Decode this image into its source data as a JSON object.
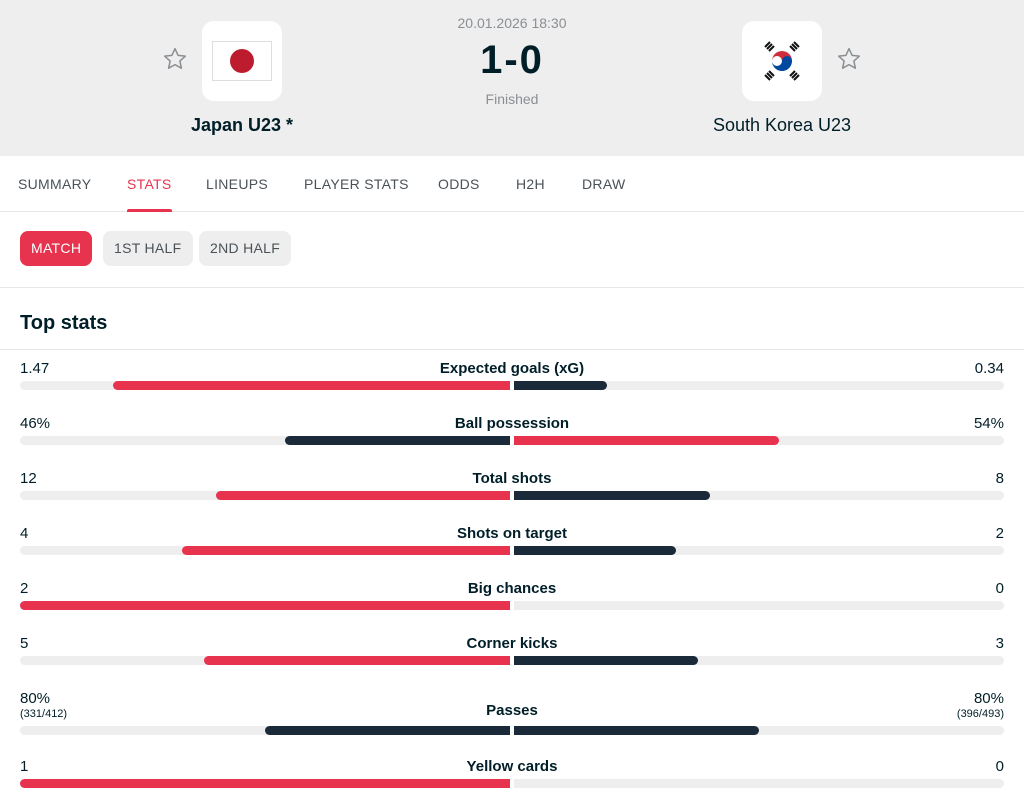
{
  "match": {
    "datetime": "20.01.2026 18:30",
    "score": "1-0",
    "status": "Finished",
    "home": {
      "name": "Japan U23 *",
      "flag_icon": "japan-flag-icon",
      "star_icon": "star-outline-icon"
    },
    "away": {
      "name": "South Korea U23",
      "flag_icon": "south-korea-flag-icon",
      "star_icon": "star-outline-icon"
    }
  },
  "tabs": [
    {
      "label": "SUMMARY",
      "active": false
    },
    {
      "label": "STATS",
      "active": true
    },
    {
      "label": "LINEUPS",
      "active": false
    },
    {
      "label": "PLAYER STATS",
      "active": false
    },
    {
      "label": "ODDS",
      "active": false
    },
    {
      "label": "H2H",
      "active": false
    },
    {
      "label": "DRAW",
      "active": false
    }
  ],
  "periods": [
    {
      "label": "MATCH",
      "active": true
    },
    {
      "label": "1ST HALF",
      "active": false
    },
    {
      "label": "2ND HALF",
      "active": false
    }
  ],
  "section": {
    "title": "Top stats"
  },
  "stats": [
    {
      "label": "Expected goals (xG)",
      "home": "1.47",
      "away": "0.34",
      "home_fill": 0.81,
      "away_fill": 0.19,
      "home_color": "red",
      "away_color": "dark"
    },
    {
      "label": "Ball possession",
      "home": "46%",
      "away": "54%",
      "home_fill": 0.46,
      "away_fill": 0.54,
      "home_color": "dark",
      "away_color": "red"
    },
    {
      "label": "Total shots",
      "home": "12",
      "away": "8",
      "home_fill": 0.6,
      "away_fill": 0.4,
      "home_color": "red",
      "away_color": "dark"
    },
    {
      "label": "Shots on target",
      "home": "4",
      "away": "2",
      "home_fill": 0.67,
      "away_fill": 0.33,
      "home_color": "red",
      "away_color": "dark"
    },
    {
      "label": "Big chances",
      "home": "2",
      "away": "0",
      "home_fill": 1.0,
      "away_fill": 0.0,
      "home_color": "red",
      "away_color": "dark"
    },
    {
      "label": "Corner kicks",
      "home": "5",
      "away": "3",
      "home_fill": 0.625,
      "away_fill": 0.375,
      "home_color": "red",
      "away_color": "dark"
    },
    {
      "label": "Passes",
      "home": "80%",
      "away": "80%",
      "home_sub": "(331/412)",
      "away_sub": "(396/493)",
      "home_fill": 0.5,
      "away_fill": 0.5,
      "home_color": "dark",
      "away_color": "dark"
    },
    {
      "label": "Yellow cards",
      "home": "1",
      "away": "0",
      "home_fill": 1.0,
      "away_fill": 0.0,
      "home_color": "red",
      "away_color": "dark"
    }
  ],
  "colors": {
    "accent": "#e8334f",
    "dark": "#1b2a38",
    "track": "#eeeeee",
    "header_bg": "#eeeeee"
  }
}
